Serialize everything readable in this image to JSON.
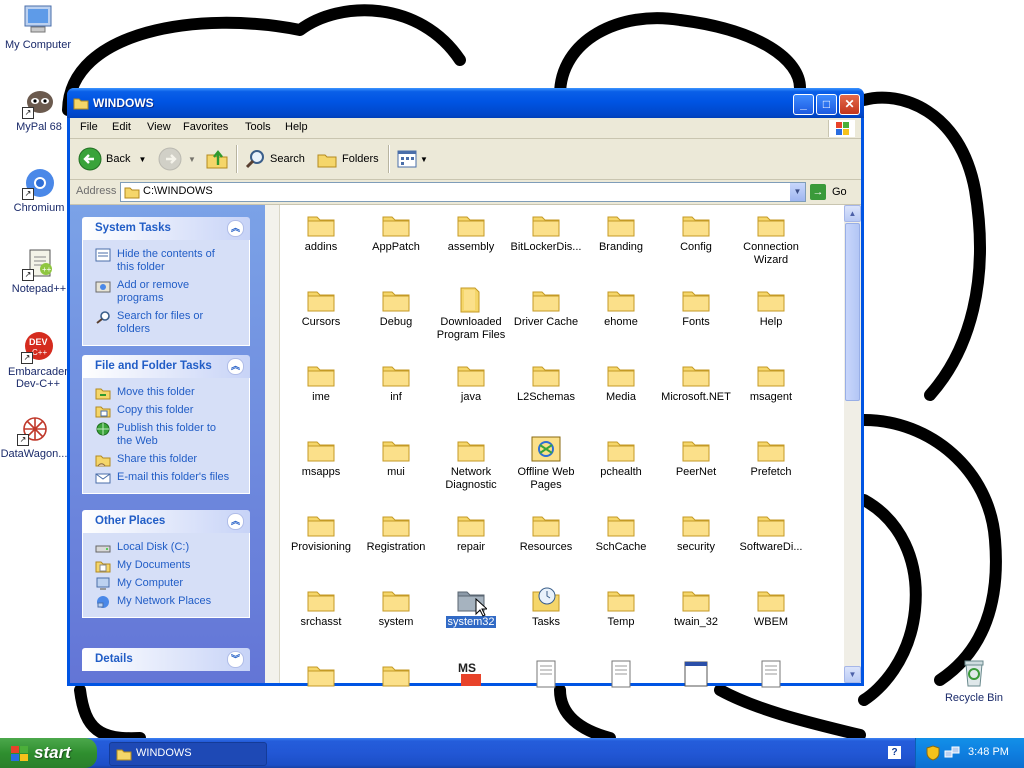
{
  "desktop": {
    "icons": [
      {
        "label": "My Computer",
        "icon": "my-computer-icon"
      },
      {
        "label": "MyPal 68",
        "icon": "mypal-icon"
      },
      {
        "label": "Chromium",
        "icon": "chromium-icon"
      },
      {
        "label": "Notepad++",
        "icon": "notepad-plus-plus-icon"
      },
      {
        "label": "Embarcader",
        "label2": "Dev-C++",
        "icon": "dev-cpp-icon"
      },
      {
        "label": "DataWagon...",
        "icon": "datawagon-icon"
      },
      {
        "label": "Recycle Bin",
        "icon": "recycle-bin-icon"
      }
    ]
  },
  "window": {
    "title": "WINDOWS",
    "menu": [
      "File",
      "Edit",
      "View",
      "Favorites",
      "Tools",
      "Help"
    ],
    "toolbar": {
      "back": "Back",
      "search": "Search",
      "folders": "Folders"
    },
    "address": {
      "label": "Address",
      "value": "C:\\WINDOWS",
      "go": "Go"
    }
  },
  "taskpane": {
    "system_tasks": {
      "title": "System Tasks",
      "items": [
        {
          "l1": "Hide the contents of",
          "l2": "this folder"
        },
        {
          "l1": "Add or remove",
          "l2": "programs"
        },
        {
          "l1": "Search for files or",
          "l2": "folders"
        }
      ]
    },
    "file_tasks": {
      "title": "File and Folder Tasks",
      "items": [
        {
          "l1": "Move this folder",
          "l2": ""
        },
        {
          "l1": "Copy this folder",
          "l2": ""
        },
        {
          "l1": "Publish this folder to",
          "l2": "the Web"
        },
        {
          "l1": "Share this folder",
          "l2": ""
        },
        {
          "l1": "E-mail this folder's files",
          "l2": ""
        }
      ]
    },
    "other_places": {
      "title": "Other Places",
      "items": [
        {
          "l1": "Local Disk (C:)",
          "l2": ""
        },
        {
          "l1": "My Documents",
          "l2": ""
        },
        {
          "l1": "My Computer",
          "l2": ""
        },
        {
          "l1": "My Network Places",
          "l2": ""
        }
      ]
    },
    "details": {
      "title": "Details"
    }
  },
  "files": [
    {
      "n1": "addins",
      "n2": ""
    },
    {
      "n1": "AppPatch",
      "n2": ""
    },
    {
      "n1": "assembly",
      "n2": ""
    },
    {
      "n1": "BitLockerDis...",
      "n2": ""
    },
    {
      "n1": "Branding",
      "n2": ""
    },
    {
      "n1": "Config",
      "n2": ""
    },
    {
      "n1": "Connection",
      "n2": "Wizard"
    },
    {
      "n1": "Cursors",
      "n2": ""
    },
    {
      "n1": "Debug",
      "n2": ""
    },
    {
      "n1": "Downloaded",
      "n2": "Program Files"
    },
    {
      "n1": "Driver Cache",
      "n2": ""
    },
    {
      "n1": "ehome",
      "n2": ""
    },
    {
      "n1": "Fonts",
      "n2": ""
    },
    {
      "n1": "Help",
      "n2": ""
    },
    {
      "n1": "ime",
      "n2": ""
    },
    {
      "n1": "inf",
      "n2": ""
    },
    {
      "n1": "java",
      "n2": ""
    },
    {
      "n1": "L2Schemas",
      "n2": ""
    },
    {
      "n1": "Media",
      "n2": ""
    },
    {
      "n1": "Microsoft.NET",
      "n2": ""
    },
    {
      "n1": "msagent",
      "n2": ""
    },
    {
      "n1": "msapps",
      "n2": ""
    },
    {
      "n1": "mui",
      "n2": ""
    },
    {
      "n1": "Network",
      "n2": "Diagnostic"
    },
    {
      "n1": "Offline Web",
      "n2": "Pages"
    },
    {
      "n1": "pchealth",
      "n2": ""
    },
    {
      "n1": "PeerNet",
      "n2": ""
    },
    {
      "n1": "Prefetch",
      "n2": ""
    },
    {
      "n1": "Provisioning",
      "n2": ""
    },
    {
      "n1": "Registration",
      "n2": ""
    },
    {
      "n1": "repair",
      "n2": ""
    },
    {
      "n1": "Resources",
      "n2": ""
    },
    {
      "n1": "SchCache",
      "n2": ""
    },
    {
      "n1": "security",
      "n2": ""
    },
    {
      "n1": "SoftwareDi...",
      "n2": ""
    },
    {
      "n1": "srchasst",
      "n2": ""
    },
    {
      "n1": "system",
      "n2": ""
    },
    {
      "n1": "system32",
      "n2": ""
    },
    {
      "n1": "Tasks",
      "n2": ""
    },
    {
      "n1": "Temp",
      "n2": ""
    },
    {
      "n1": "twain_32",
      "n2": ""
    },
    {
      "n1": "WBEM",
      "n2": ""
    }
  ],
  "taskbar": {
    "start": "start",
    "window_button": "WINDOWS",
    "clock": "3:48 PM",
    "help": "?"
  },
  "colors": {
    "xp_blue": "#0054e3",
    "folder_yellow": "#f5d66a",
    "taskbar": "#245ddb",
    "start_green": "#3c9a3c"
  }
}
